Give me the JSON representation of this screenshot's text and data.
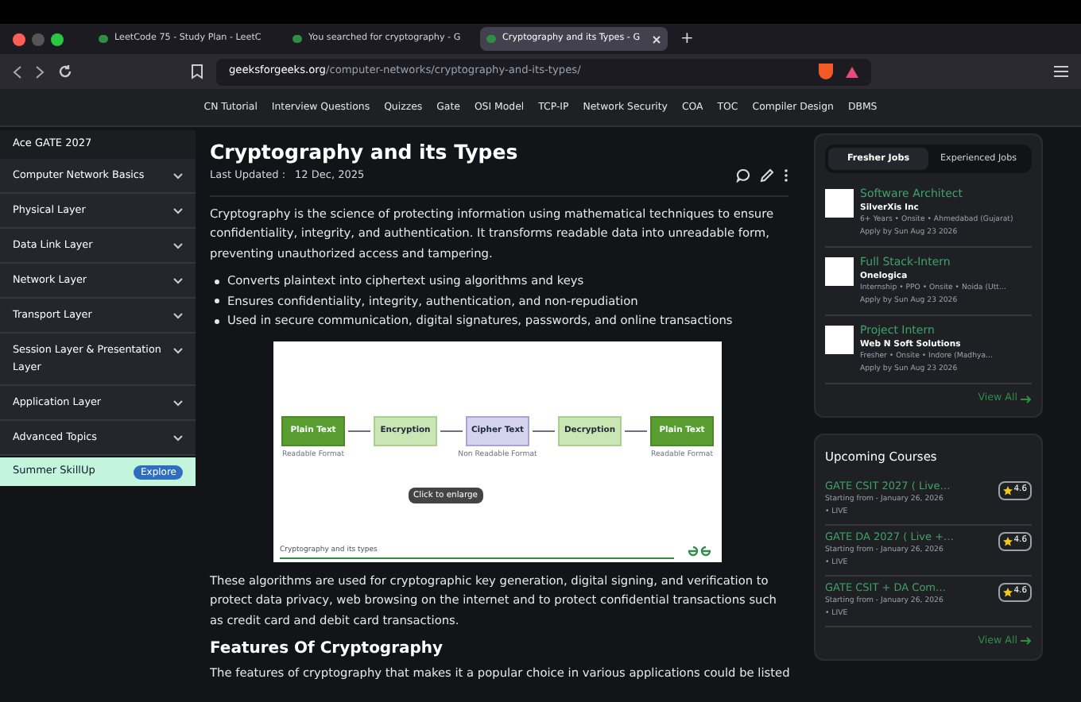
{
  "browser": {
    "tabs": [
      {
        "title": "LeetCode 75 - Study Plan - LeetC",
        "selected": false
      },
      {
        "title": "You searched for cryptography - G",
        "selected": false
      },
      {
        "title": "Cryptography and its Types - G",
        "selected": true
      }
    ],
    "new_tab": "+",
    "url_host": "geeksforgeeks.org",
    "url_path": "/computer-networks/cryptography-and-its-types/"
  },
  "nav": [
    "CN Tutorial",
    "Interview Questions",
    "Quizzes",
    "Gate",
    "OSI Model",
    "TCP-IP",
    "Network Security",
    "COA",
    "TOC",
    "Compiler Design",
    "DBMS"
  ],
  "sidebar": {
    "header": "Ace GATE 2027",
    "items": [
      "Computer Network Basics",
      "Physical Layer",
      "Data Link Layer",
      "Network Layer",
      "Transport Layer",
      "Session Layer & Presentation Layer",
      "Application Layer",
      "Advanced Topics"
    ],
    "promo": {
      "label": "Summer SkillUp",
      "button": "Explore"
    }
  },
  "article": {
    "title": "Cryptography and its Types",
    "updated_label": "Last Updated :",
    "updated_date": "12 Dec, 2025",
    "intro": "Cryptography is the science of protecting information using mathematical techniques to ensure confidentiality, integrity, and authentication. It transforms readable data into unreadable form, preventing unauthorized access and tampering.",
    "bullets": [
      "Converts plaintext into ciphertext using algorithms and keys",
      "Ensures confidentiality, integrity, authentication, and non-repudiation",
      "Used in secure communication, digital signatures, passwords, and online transactions"
    ],
    "figure": {
      "nodes": [
        {
          "label": "Plain Text",
          "kind": "plain",
          "caption": "Readable Format"
        },
        {
          "label": "Encryption",
          "kind": "process"
        },
        {
          "label": "Cipher Text",
          "kind": "cipher",
          "caption": "Non Readable Format"
        },
        {
          "label": "Decryption",
          "kind": "process"
        },
        {
          "label": "Plain Text",
          "kind": "plain",
          "caption": "Readable Format"
        }
      ],
      "tooltip": "Click to enlarge",
      "footer": "Cryptography and its types"
    },
    "after": "These algorithms are used for cryptographic key generation, digital signing, and verification to protect data privacy, web browsing on the internet and to protect confidential transactions such as credit card and debit card transactions.",
    "subheading": "Features Of Cryptography",
    "cut_line": "The features of cryptography that makes it a popular choice in various applications could be listed"
  },
  "jobs": {
    "tabs": [
      {
        "label": "Fresher Jobs",
        "selected": true
      },
      {
        "label": "Experienced Jobs",
        "selected": false
      }
    ],
    "items": [
      {
        "title": "Software Architect",
        "company": "SilverXis Inc",
        "meta": "6+ Years • Onsite • Ahmedabad (Gujarat)",
        "apply": "Apply by Sun Aug 23 2026"
      },
      {
        "title": "Full Stack-Intern",
        "company": "Onelogica",
        "meta": "Internship • PPO • Onsite • Noida (Utt...",
        "apply": "Apply by Sun Aug 23 2026"
      },
      {
        "title": "Project Intern",
        "company": "Web N Soft Solutions",
        "meta": "Fresher • Onsite • Indore (Madhya...",
        "apply": "Apply by Sun Aug 23 2026"
      }
    ],
    "view_all": "View All"
  },
  "courses": {
    "title": "Upcoming Courses",
    "items": [
      {
        "name": "GATE CSIT 2027 ( Live…",
        "start": "Starting from - January 26, 2026",
        "status": "• LIVE",
        "rating": "4.6"
      },
      {
        "name": "GATE DA 2027 ( Live +…",
        "start": "Starting from - January 26, 2026",
        "status": "• LIVE",
        "rating": "4.6"
      },
      {
        "name": "GATE CSIT + DA Com…",
        "start": "Starting from - January 26, 2026",
        "status": "• LIVE",
        "rating": "4.6"
      }
    ],
    "view_all": "View All"
  }
}
